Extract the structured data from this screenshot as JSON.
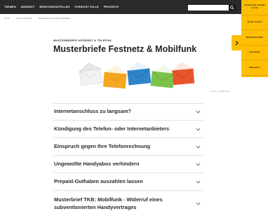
{
  "nav": {
    "items": [
      "THEMEN",
      "ANGEBOT",
      "BERATUNGSSTELLEN",
      "VORSICHT FALLE",
      "PROJEKTE"
    ],
    "search": {
      "placeholder": "",
      "value": ""
    }
  },
  "sidebar": {
    "items": [
      "Verbraucher-zentrale vor Ort",
      "Termin buchen",
      "Beratungsstellen",
      "Newsletter",
      "Mitmachen"
    ]
  },
  "breadcrumb": [
    "Home",
    "Internet & Telefon",
    "Musterbriefe Festnetz & Mobilfunk"
  ],
  "article": {
    "kicker": "MUSTERBRIEFE INTERNET & TELEFON",
    "title": "Musterbriefe Festnetz & Mobilfunk",
    "image_caption": "© pico – Fotolia.com"
  },
  "accordion": [
    "Internetanschluss zu langsam?",
    "Kündigung des Telefon- oder Internetanbieters",
    "Einspruch gegen Ihre Telefonrechnung",
    "Ungewollte Handyabos verhindern",
    "Prepaid-Guthaben auszahlen lassen",
    "Musterbrief TKB: Mobilfunk - Widerruf eines subventionierten Handyvertrages"
  ],
  "colors": {
    "nav_bg": "#2a2a2a",
    "accent": "#ffbf00",
    "envelopes": [
      "#f2f2f2",
      "#f5a623",
      "#2e86c9",
      "#7dc24b",
      "#e8552c"
    ]
  }
}
